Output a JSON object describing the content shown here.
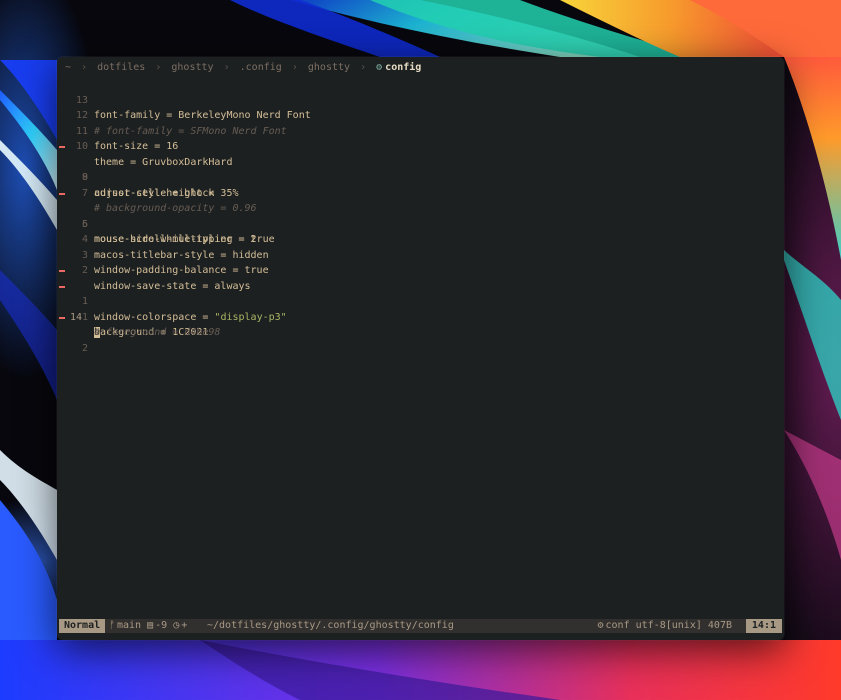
{
  "breadcrumb": {
    "home": "~",
    "segments": [
      "dotfiles",
      "ghostty",
      ".config",
      "ghostty"
    ],
    "separator": "›",
    "current": "config",
    "current_icon": "gear-icon"
  },
  "editor": {
    "lines": [
      {
        "num": "13",
        "text": "font-family = BerkeleyMono Nerd Font",
        "comment": false,
        "sign": false
      },
      {
        "num": "12",
        "text": "# font-family = SFMono Nerd Font",
        "comment": true,
        "sign": false
      },
      {
        "num": "11",
        "text": "font-size = 16",
        "comment": false,
        "sign": false
      },
      {
        "num": "10",
        "text": "theme = GruvboxDarkHard",
        "comment": false,
        "sign": false
      },
      {
        "num": "9",
        "text": "cursor-style = block",
        "comment": false,
        "sign": true
      },
      {
        "num": "8",
        "text": "adjust-cell-height = 35%",
        "comment": false,
        "sign": false
      },
      {
        "num": "7",
        "text": "# background-opacity = 0.96",
        "comment": true,
        "sign": false
      },
      {
        "num": "6",
        "text": "mouse-hide-while-typing = true",
        "comment": false,
        "sign": true
      },
      {
        "num": "5",
        "text": "mouse-scroll-multiplier = 2",
        "comment": false,
        "sign": false
      },
      {
        "num": "4",
        "text": "macos-titlebar-style = hidden",
        "comment": false,
        "sign": false
      },
      {
        "num": "3",
        "text": "window-padding-balance = true",
        "comment": false,
        "sign": false
      },
      {
        "num": "2",
        "text": "window-save-state = always",
        "comment": false,
        "sign": false
      },
      {
        "num": "1",
        "text_prefix": "window-colorspace = ",
        "text_string": "\"display-p3\"",
        "comment": false,
        "sign": true
      },
      {
        "num": "14",
        "cursor_char": "b",
        "text_rest": "ackground = 1C2021",
        "comment": false,
        "sign": true,
        "current": true
      },
      {
        "num": "1",
        "text": "# foreground = d4be98",
        "comment": true,
        "sign": false
      },
      {
        "num": "2",
        "text": "",
        "comment": false,
        "sign": true
      }
    ]
  },
  "statusline": {
    "mode": "Normal",
    "branch_icon": "git-branch-icon",
    "branch": "main",
    "file_icon": "file-icon",
    "diff_count": "-9",
    "clock_icon": "clock-icon",
    "plus": "+",
    "path": "~/dotfiles/ghostty/.config/ghostty/config",
    "filetype_icon": "gear-icon",
    "filetype": "conf",
    "encoding": "utf-8[unix]",
    "size": "407B",
    "position": "14:1"
  },
  "colors": {
    "background": "#1d2021",
    "foreground": "#d4be98",
    "comment": "#665c54",
    "string": "#a9b665",
    "sign": "#ea6962",
    "statusline_bg": "#32302f",
    "mode_bg": "#a89984"
  }
}
